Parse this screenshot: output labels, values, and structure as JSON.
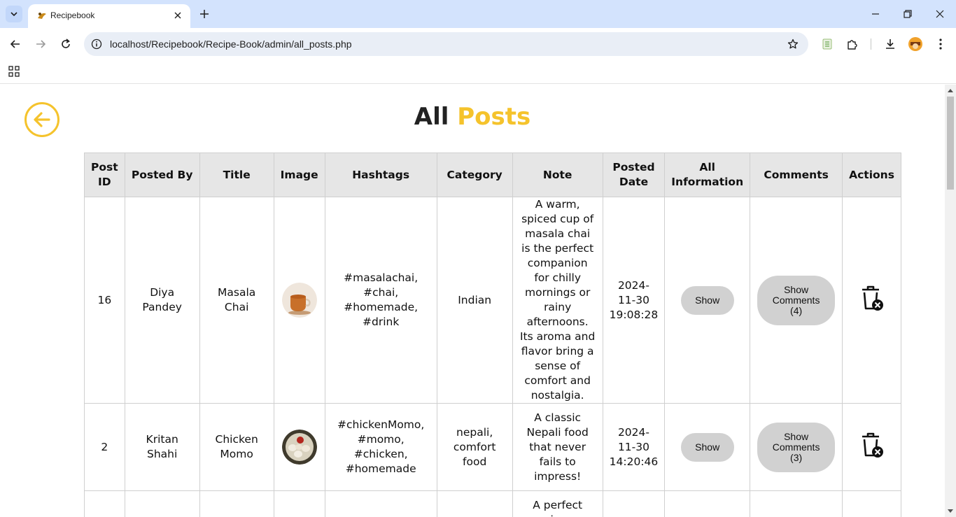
{
  "browser": {
    "tab_title": "Recipebook",
    "url": "localhost/Recipebook/Recipe-Book/admin/all_posts.php"
  },
  "page": {
    "heading_main": "All",
    "heading_accent": "Posts"
  },
  "table": {
    "headers": {
      "post_id": "Post ID",
      "posted_by": "Posted By",
      "title": "Title",
      "image": "Image",
      "hashtags": "Hashtags",
      "category": "Category",
      "note": "Note",
      "posted_date": "Posted Date",
      "all_information": "All Information",
      "comments": "Comments",
      "actions": "Actions"
    },
    "rows": [
      {
        "post_id": "16",
        "posted_by": "Diya Pandey",
        "title": "Masala Chai",
        "image_desc": "cup of masala chai",
        "hashtags": "#masalachai, #chai, #homemade, #drink",
        "category": "Indian",
        "note": "A warm, spiced cup of masala chai is the perfect companion for chilly mornings or rainy afternoons. Its aroma and flavor bring a sense of comfort and nostalgia.",
        "posted_date": "2024-11-30 19:08:28",
        "show_label": "Show",
        "comments_label": "Show Comments (4)"
      },
      {
        "post_id": "2",
        "posted_by": "Kritan Shahi",
        "title": "Chicken Momo",
        "image_desc": "plate of chicken momo",
        "hashtags": "#chickenMomo, #momo, #chicken, #homemade",
        "category": "nepali, comfort food",
        "note": "A classic Nepali food that never fails to impress!",
        "posted_date": "2024-11-30 14:20:46",
        "show_label": "Show",
        "comments_label": "Show Comments (3)"
      },
      {
        "post_id": "",
        "posted_by": "",
        "title": "",
        "hashtags": "",
        "category": "",
        "note": "A perfect pizza",
        "posted_date": ""
      }
    ]
  },
  "colors": {
    "accent": "#f5c32c",
    "header_bg": "#e6e6e6",
    "button_bg": "#d1d1d1"
  }
}
